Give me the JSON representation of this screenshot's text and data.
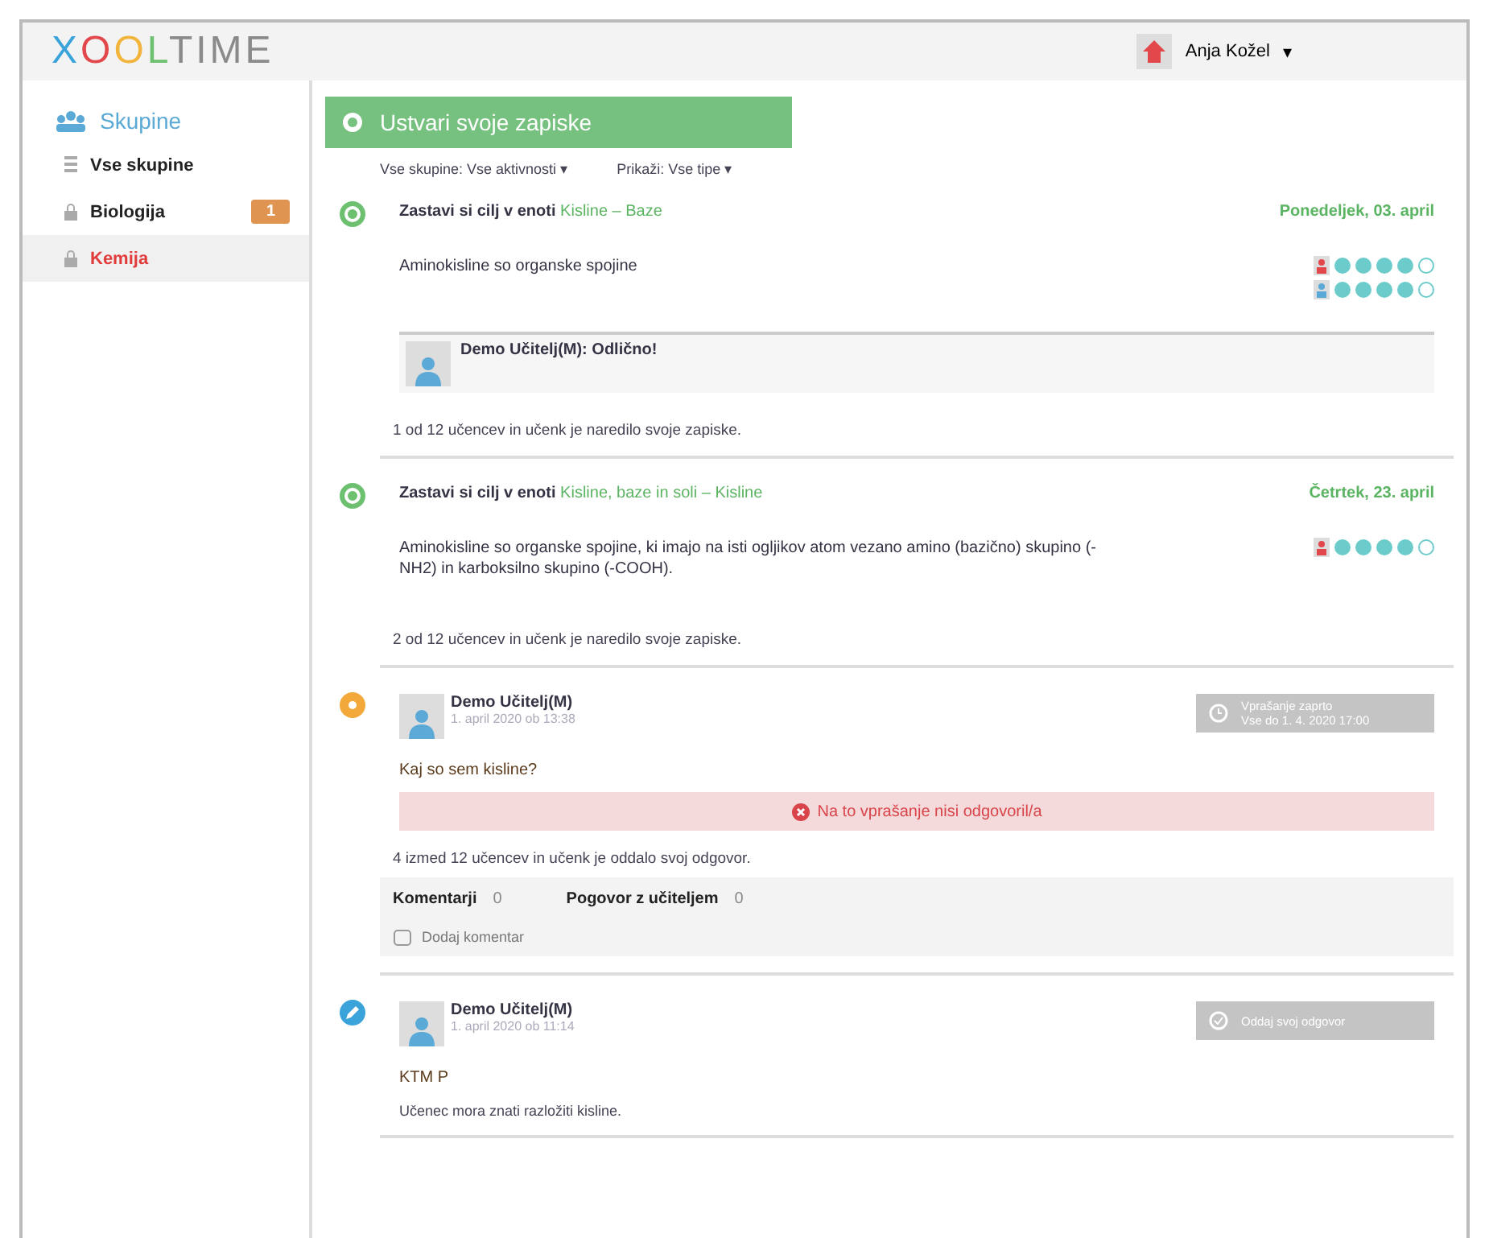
{
  "header": {
    "logo": [
      {
        "text": "X",
        "color": "#3aa3d9"
      },
      {
        "text": "O",
        "color": "#e2474c"
      },
      {
        "text": "O",
        "color": "#f2b43a"
      },
      {
        "text": "L",
        "color": "#6cc070"
      },
      {
        "text": "TIME",
        "color": "#8a8a8a"
      }
    ],
    "user": "Anja Kožel",
    "caret": "▾"
  },
  "sidebar": {
    "title": "Skupine",
    "items": [
      {
        "label": "Vse skupine",
        "kind": "all",
        "selected": false
      },
      {
        "label": "Biologija",
        "kind": "locked",
        "selected": false,
        "badge": "1"
      },
      {
        "label": "Kemija",
        "kind": "locked",
        "selected": true
      }
    ]
  },
  "banner": "Ustvari svoje zapiske",
  "filters": [
    {
      "label": "Vse skupine: Vse aktivnosti",
      "caret": "▾"
    },
    {
      "label": "Prikaži: Vse tipe",
      "caret": "▾"
    }
  ],
  "feed": [
    {
      "kind": "goal",
      "lead": "Zastavi si cilj v enoti ",
      "unit": "Kisline – Baze",
      "date": "Ponedeljek, 03. april",
      "text": "Aminokisline so organske spojine",
      "ratings": [
        {
          "kind": "self",
          "stars": 4
        },
        {
          "kind": "teacher",
          "stars": 4
        }
      ],
      "comment": "Demo Učitelj(M): Odlično!",
      "summary": "1 od 12 učencev in učenk je naredilo svoje zapiske."
    },
    {
      "kind": "goal",
      "lead": "Zastavi si cilj v enoti ",
      "unit": "Kisline, baze in soli – Kisline",
      "date": "Četrtek, 23. april",
      "text": "Aminokisline so organske spojine, ki imajo na isti ogljikov atom vezano amino (bazično) skupino (-NH2) in karboksilno skupino (-COOH).",
      "ratings": [
        {
          "kind": "self",
          "stars": 4
        }
      ],
      "summary": "2 od 12 učencev in učenk je naredilo svoje zapiske."
    },
    {
      "kind": "question",
      "author": "Demo Učitelj(M)",
      "time": "1. april 2020 ob 13:38",
      "action": [
        "Vprašanje zaprto",
        "Vse do 1. 4. 2020 17:00"
      ],
      "text": "Kaj so sem kisline?",
      "alert": "Na to vprašanje nisi odgovoril/a",
      "summary": "4 izmed 12 učencev in učenk je oddalo svoj odgovor.",
      "tabs": [
        {
          "label": "Komentarji",
          "count": "0"
        },
        {
          "label": "Pogovor z učiteljem",
          "count": "0"
        }
      ],
      "add": "Dodaj komentar"
    },
    {
      "kind": "task",
      "author": "Demo Učitelj(M)",
      "time": "1. april 2020 ob 11:14",
      "action": [
        "Oddaj svoj odgovor"
      ],
      "text": "KTM P",
      "note": "Učenec mora znati razložiti kisline."
    }
  ]
}
